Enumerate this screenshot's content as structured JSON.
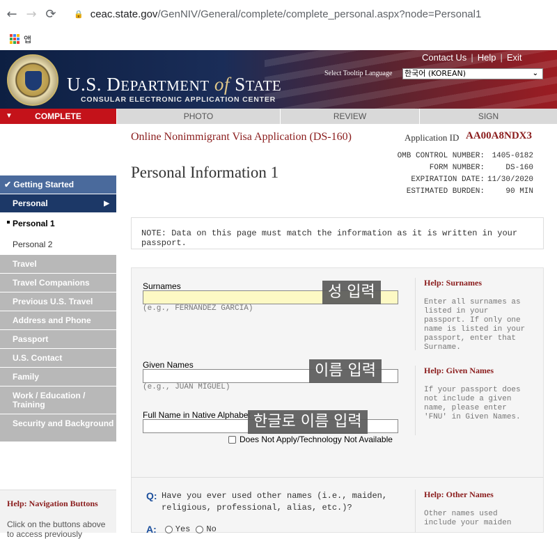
{
  "browser": {
    "url_host": "ceac.state.gov",
    "url_path": "/GenNIV/General/complete/complete_personal.aspx?node=Personal1",
    "bookmark_label": "앱"
  },
  "header": {
    "dept_prefix": "U.S. D",
    "dept_text": "U.S. DEPARTMENT",
    "dept_of": "of",
    "dept_state": "STATE",
    "subtitle": "CONSULAR ELECTRONIC APPLICATION CENTER",
    "links": [
      "Contact Us",
      "Help",
      "Exit"
    ],
    "tooltip_language_label": "Select Tooltip Language",
    "tooltip_language_value": "한국어 (KOREAN)"
  },
  "tabs": [
    "COMPLETE",
    "PHOTO",
    "REVIEW",
    "SIGN"
  ],
  "leftnav": {
    "getting_started": "Getting Started",
    "section": "Personal",
    "current": "Personal 1",
    "sub": "Personal 2",
    "locked": [
      "Travel",
      "Travel Companions",
      "Previous U.S. Travel",
      "Address and Phone",
      "Passport",
      "U.S. Contact",
      "Family",
      "Work / Education / Training",
      "Security and Background"
    ]
  },
  "navhelp": {
    "help_label": "Help:",
    "title": "Navigation Buttons",
    "text": "Click on the buttons above to access previously"
  },
  "main": {
    "form_title": "Online Nonimmigrant Visa Application (DS-160)",
    "app_id_label": "Application ID",
    "app_id": "AA00A8NDX3",
    "page_title": "Personal Information 1",
    "omb": [
      {
        "k": "OMB CONTROL NUMBER:",
        "v": "1405-0182"
      },
      {
        "k": "FORM NUMBER:",
        "v": "DS-160"
      },
      {
        "k": "EXPIRATION DATE:",
        "v": "11/30/2020"
      },
      {
        "k": "ESTIMATED BURDEN:",
        "v": "90 MIN"
      }
    ],
    "note": "NOTE: Data on this page must match the information as it is written in your passport."
  },
  "form": {
    "surnames_label": "Surnames",
    "surnames_hint": "(e.g., FERNANDEZ GARCIA)",
    "surnames_overlay": "성 입력",
    "given_label": "Given Names",
    "given_hint": "(e.g., JUAN MIGUEL)",
    "given_overlay": "이름 입력",
    "native_label": "Full Name in Native Alphabet",
    "native_overlay": "한글로 이름 입력",
    "does_not_apply": "Does Not Apply/Technology Not Available",
    "help_label": "Help:",
    "help_surnames_title": "Surnames",
    "help_surnames_text": "Enter all surnames as listed in your passport. If only one name is listed in your passport, enter that Surname.",
    "help_given_title": "Given Names",
    "help_given_text": "If your passport does not include a given name, please enter 'FNU' in Given Names.",
    "help_other_title": "Other Names",
    "help_other_text": "Other names used include your maiden",
    "question_marker": "Q:",
    "question": "Have you ever used other names (i.e., maiden, religious, professional, alias, etc.)?",
    "answer_marker": "A:",
    "yes": "Yes",
    "no": "No"
  }
}
